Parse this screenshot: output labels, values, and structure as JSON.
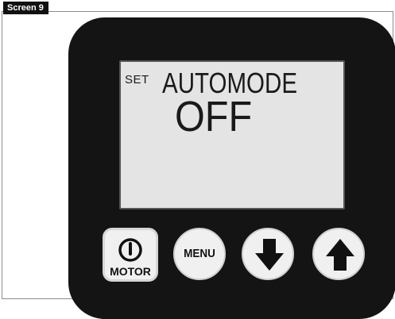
{
  "screen_label": "Screen 9",
  "display": {
    "prefix": "SET",
    "mode": "AUTOMODE",
    "value": "OFF"
  },
  "buttons": {
    "motor": {
      "label": "MOTOR",
      "icon": "power-icon"
    },
    "menu": {
      "label": "MENU"
    },
    "down": {
      "icon": "arrow-down-icon"
    },
    "up": {
      "icon": "arrow-up-icon"
    }
  },
  "colors": {
    "device_body": "#141414",
    "display_bg": "#e4e4e4",
    "button_face": "#f0f0f0",
    "text": "#111111"
  }
}
